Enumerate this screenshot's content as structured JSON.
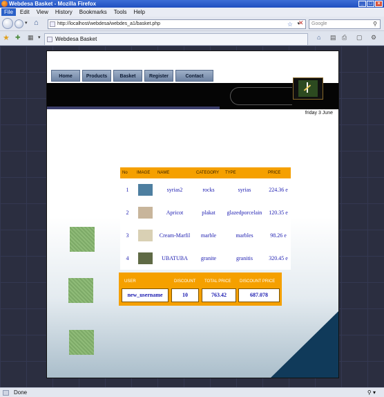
{
  "window": {
    "title": "Webdesa Basket - Mozilla Firefox",
    "controls": [
      "_",
      "□",
      "×"
    ]
  },
  "menu": {
    "items": [
      "File",
      "Edit",
      "View",
      "History",
      "Bookmarks",
      "Tools",
      "Help"
    ]
  },
  "navigation": {
    "url": "http://localhost/webdesa/webdes_a1/basket.php",
    "search_placeholder": "Google"
  },
  "tabs": [
    {
      "label": "Webdesa Basket"
    }
  ],
  "site": {
    "nav": [
      "Home",
      "Products",
      "Basket",
      "Register",
      "Contact"
    ],
    "date": "friday 3 June"
  },
  "basket": {
    "headers": [
      "No",
      "IMAGE",
      "NAME",
      "CATEGORY",
      "TYPE",
      "PRICE"
    ],
    "rows": [
      {
        "no": "1",
        "name": "syrias2",
        "category": "rocks",
        "type": "syrias",
        "price": "224.36 e",
        "thumb_color": "#4e7fa0"
      },
      {
        "no": "2",
        "name": "Apricot",
        "category": "plakat",
        "type": "glazedporcelain",
        "price": "120.35 e",
        "thumb_color": "#c8b59b"
      },
      {
        "no": "3",
        "name": "Cream-Marfil",
        "category": "marble",
        "type": "marbles",
        "price": "98.26 e",
        "thumb_color": "#d9d0b4"
      },
      {
        "no": "4",
        "name": "UBATUBA",
        "category": "granite",
        "type": "granitis",
        "price": "320.45 e",
        "thumb_color": "#5f6a45"
      }
    ]
  },
  "summary": {
    "headers": [
      "USER",
      "DISCOUNT",
      "TOTAL PRICE",
      "DISCOUNT PRICE"
    ],
    "user": "new_username",
    "discount": "10",
    "total_price": "763.42",
    "discount_price": "687.078"
  },
  "status": {
    "text": "Done"
  },
  "colors": {
    "accent": "#f5a000",
    "link": "#1b1bb0",
    "header_band": "#050505",
    "corner": "#103a5a"
  }
}
